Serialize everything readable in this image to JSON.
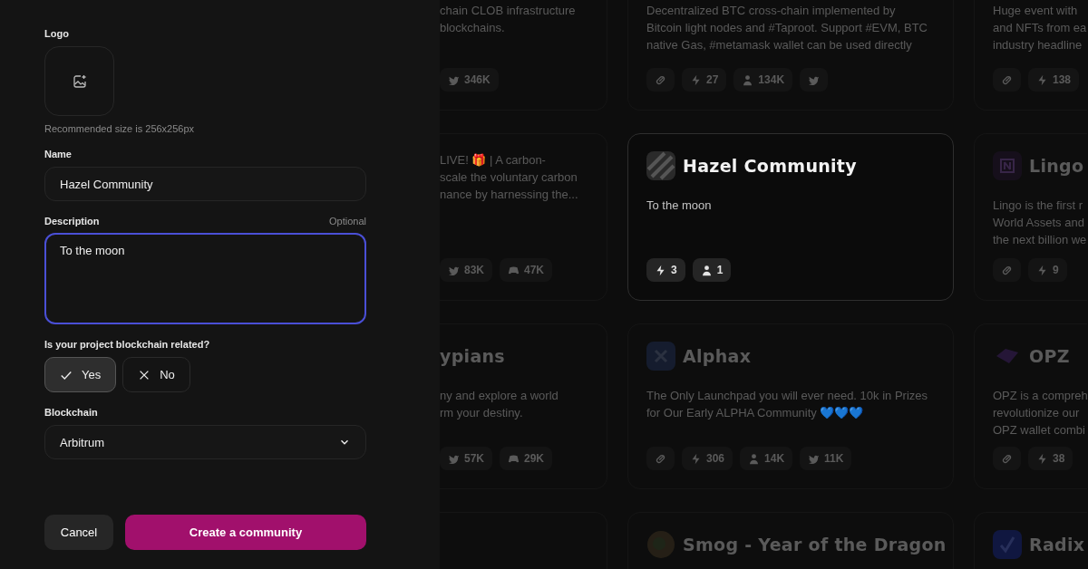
{
  "form": {
    "logo_label": "Logo",
    "logo_hint": "Recommended size is 256x256px",
    "name_label": "Name",
    "name_value": "Hazel Community",
    "description_label": "Description",
    "description_note": "Optional",
    "description_value": "To the moon",
    "question": "Is your project blockchain related?",
    "options": [
      {
        "label": "Yes",
        "kind": "check",
        "selected": true
      },
      {
        "label": "No",
        "kind": "cross",
        "selected": false
      }
    ],
    "blockchain_label": "Blockchain",
    "blockchain_value": "Arbitrum",
    "cancel": "Cancel",
    "submit": "Create a community"
  },
  "card_rows": [
    [
      {
        "highlighted": false,
        "description_lines": [
          "chain CLOB infrastructure",
          "blockchains."
        ],
        "stats": [
          {
            "kind": "bird",
            "value": "346K"
          }
        ]
      },
      {
        "highlighted": false,
        "description_lines": [
          "Decentralized BTC cross-chain implemented by",
          "Bitcoin light nodes and #Taproot. Support #EVM, BTC",
          "native Gas, #metamask wallet can be used directly"
        ],
        "stats": [
          {
            "kind": "link"
          },
          {
            "kind": "bolt",
            "value": "27"
          },
          {
            "kind": "person",
            "value": "134K"
          },
          {
            "kind": "bird"
          }
        ]
      },
      {
        "highlighted": false,
        "description_lines": [
          "Huge event with",
          "and NFTs from ea",
          "industry headline"
        ],
        "stats": [
          {
            "kind": "link"
          },
          {
            "kind": "bolt",
            "value": "138"
          }
        ]
      }
    ],
    [
      {
        "highlighted": false,
        "description_lines": [
          "LIVE! 🎁 | A carbon-",
          "scale the voluntary carbon",
          "nance by harnessing the..."
        ],
        "stats": [
          {
            "kind": "bird",
            "value": "83K"
          },
          {
            "kind": "controller",
            "value": "47K"
          }
        ]
      },
      {
        "highlighted": true,
        "logo": {
          "kind": "stripes"
        },
        "title": "Hazel Community",
        "description_lines": [
          "To the moon"
        ],
        "stats": [
          {
            "kind": "bolt",
            "value": "3"
          },
          {
            "kind": "person",
            "value": "1"
          }
        ]
      },
      {
        "highlighted": false,
        "logo": {
          "kind": "letter"
        },
        "title": "Lingo",
        "description_lines": [
          "Lingo is the first r",
          "World Assets and",
          "the next billion we"
        ],
        "stats": [
          {
            "kind": "link"
          },
          {
            "kind": "bolt",
            "value": "9"
          }
        ]
      }
    ],
    [
      {
        "highlighted": false,
        "title": "ypians",
        "description_lines": [
          "ny and explore a world",
          "rm your destiny."
        ],
        "stats": [
          {
            "kind": "bird",
            "value": "57K"
          },
          {
            "kind": "controller",
            "value": "29K"
          }
        ]
      },
      {
        "highlighted": false,
        "logo": {
          "kind": "cross"
        },
        "title": "Alphax",
        "description_lines": [
          "The Only Launchpad you will ever need. 10k in Prizes",
          "for Our Early ALPHA Community 💙💙💙"
        ],
        "stats": [
          {
            "kind": "link"
          },
          {
            "kind": "bolt",
            "value": "306"
          },
          {
            "kind": "person",
            "value": "14K"
          },
          {
            "kind": "bird",
            "value": "11K"
          }
        ]
      },
      {
        "highlighted": false,
        "logo": {
          "kind": "ribbon"
        },
        "title": "OPZ",
        "description_lines": [
          "OPZ is a compreh",
          "revolutionize our",
          "OPZ wallet combi"
        ],
        "stats": [
          {
            "kind": "link"
          },
          {
            "kind": "bolt",
            "value": "38"
          }
        ]
      }
    ],
    [
      {
        "highlighted": false
      },
      {
        "highlighted": false,
        "logo": {
          "kind": "round"
        },
        "title": "Smog - Year of the Dragon"
      },
      {
        "highlighted": false,
        "logo": {
          "kind": "tick"
        },
        "title": "Radix"
      }
    ]
  ]
}
